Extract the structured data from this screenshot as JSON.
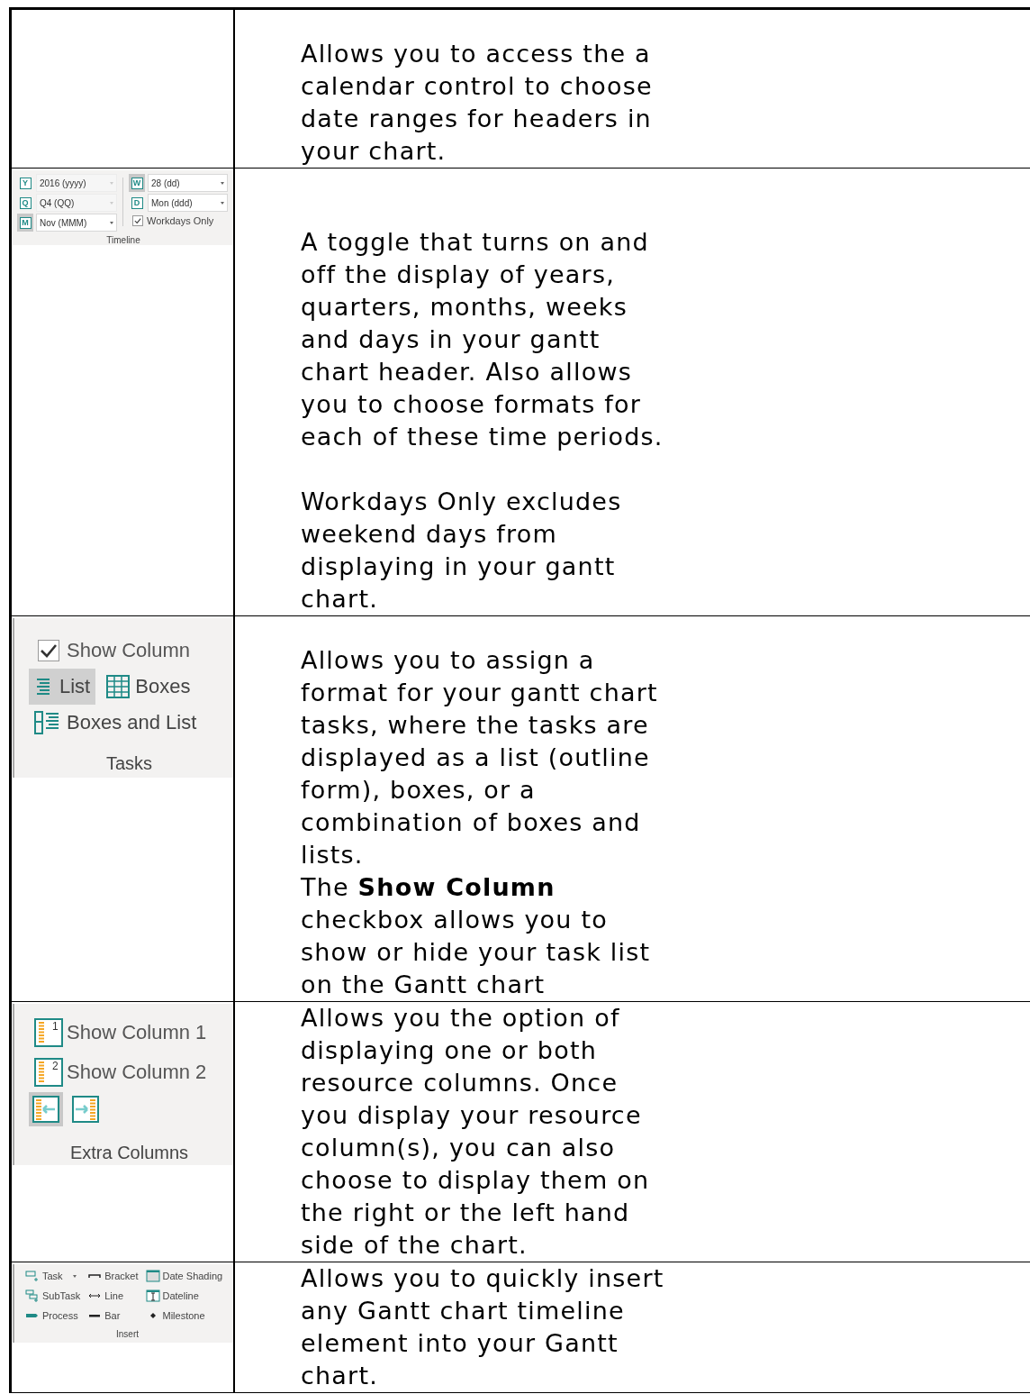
{
  "table": {
    "rows": [
      {
        "ribbon": {
          "kind": "none"
        },
        "description": "Allows you to access the a calendar control to choose date ranges for headers in your chart."
      },
      {
        "ribbon": {
          "kind": "timeline",
          "group_label": "Timeline",
          "left": [
            {
              "key": "Y",
              "value": "2016 (yyyy)",
              "selected": false,
              "disabled": true
            },
            {
              "key": "Q",
              "value": "Q4 (QQ)",
              "selected": false,
              "disabled": true
            },
            {
              "key": "M",
              "value": "Nov (MMM)",
              "selected": true,
              "disabled": false
            }
          ],
          "right": [
            {
              "key": "W",
              "value": "28 (dd)",
              "selected": true,
              "disabled": false
            },
            {
              "key": "D",
              "value": "Mon (ddd)",
              "selected": false,
              "disabled": false
            }
          ],
          "checkbox": {
            "label": "Workdays Only",
            "checked": true
          }
        },
        "description": "A toggle that turns on and off the display of years, quarters, months, weeks and days in your gantt chart header. Also allows you to choose formats for each of these time periods.\n\nWorkdays Only excludes weekend days from displaying in your gantt chart."
      },
      {
        "ribbon": {
          "kind": "tasks",
          "group_label": "Tasks",
          "checkbox": {
            "label": "Show Column",
            "checked": true
          },
          "options": [
            {
              "label": "List",
              "kind": "list",
              "selected": true
            },
            {
              "label": "Boxes",
              "kind": "boxes",
              "selected": false
            },
            {
              "label": "Boxes and List",
              "kind": "boxes_list",
              "selected": false
            }
          ]
        },
        "description": "Allows you to assign a format for your gantt chart tasks, where the tasks are displayed as a list (outline form), boxes, or a combination of boxes and lists.\nThe **Show Column** checkbox allows you to show or hide your task list on the Gantt chart"
      },
      {
        "ribbon": {
          "kind": "extra_columns",
          "group_label": "Extra Columns",
          "columns": [
            {
              "number": "1",
              "label": "Show Column 1"
            },
            {
              "number": "2",
              "label": "Show Column 2"
            }
          ],
          "sides": [
            {
              "kind": "left",
              "selected": true
            },
            {
              "kind": "right",
              "selected": false
            }
          ]
        },
        "description": "Allows you the option of displaying one or both resource columns. Once you display your resource column(s), you can also choose to display them on the right or the left hand side of the chart."
      },
      {
        "ribbon": {
          "kind": "insert",
          "group_label": "Insert",
          "columns": [
            [
              {
                "kind": "task",
                "label": "Task",
                "dropdown": true
              },
              {
                "kind": "subtask",
                "label": "SubTask",
                "dropdown": false
              },
              {
                "kind": "process",
                "label": "Process",
                "dropdown": false
              }
            ],
            [
              {
                "kind": "bracket",
                "label": "Bracket",
                "dropdown": false
              },
              {
                "kind": "line",
                "label": "Line",
                "dropdown": false
              },
              {
                "kind": "bar",
                "label": "Bar",
                "dropdown": false
              }
            ],
            [
              {
                "kind": "date_shading",
                "label": "Date Shading",
                "dropdown": false
              },
              {
                "kind": "dateline",
                "label": "Dateline",
                "dropdown": false
              },
              {
                "kind": "milestone",
                "label": "Milestone",
                "dropdown": false
              }
            ]
          ]
        },
        "description": "Allows you to quickly insert any Gantt chart timeline element into your Gantt chart."
      }
    ]
  }
}
